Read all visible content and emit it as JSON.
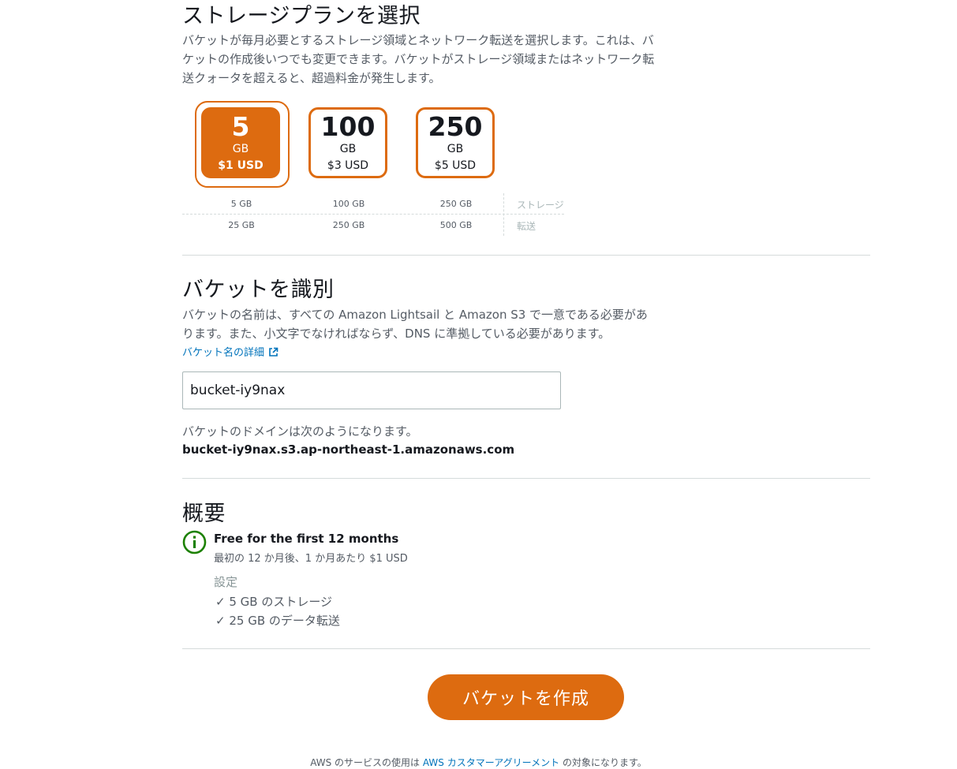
{
  "storage_plan": {
    "title": "ストレージプランを選択",
    "description": "バケットが毎月必要とするストレージ領域とネットワーク転送を選択します。これは、バケットの作成後いつでも変更できます。バケットがストレージ領域またはネットワーク転送クォータを超えると、超過料金が発生します。",
    "plans": [
      {
        "size": "5",
        "unit": "GB",
        "price": "$1 USD",
        "storage": "5 GB",
        "transfer": "25 GB",
        "selected": true
      },
      {
        "size": "100",
        "unit": "GB",
        "price": "$3 USD",
        "storage": "100 GB",
        "transfer": "250 GB",
        "selected": false
      },
      {
        "size": "250",
        "unit": "GB",
        "price": "$5 USD",
        "storage": "250 GB",
        "transfer": "500 GB",
        "selected": false
      }
    ],
    "row_labels": {
      "storage": "ストレージ",
      "transfer": "転送"
    }
  },
  "identify": {
    "title": "バケットを識別",
    "description": "バケットの名前は、すべての Amazon Lightsail と Amazon S3 で一意である必要があります。また、小文字でなければならず、DNS に準拠している必要があります。",
    "link_label": "バケット名の詳細",
    "bucket_name": "bucket-iy9nax",
    "domain_label": "バケットのドメインは次のようになります。",
    "domain_value": "bucket-iy9nax.s3.ap-northeast-1.amazonaws.com"
  },
  "summary": {
    "title": "概要",
    "free_title": "Free for the first 12 months",
    "free_sub": "最初の 12 か月後、1 か月あたり $1 USD",
    "settings_label": "設定",
    "items": [
      "✓ 5 GB のストレージ",
      "✓ 25 GB のデータ転送"
    ]
  },
  "actions": {
    "create_label": "バケットを作成"
  },
  "footer": {
    "prefix": "AWS のサービスの使用は",
    "link": "AWS カスタマーアグリーメント",
    "suffix": "の対象になります。"
  },
  "colors": {
    "accent": "#dd6b10",
    "link": "#0073bb",
    "info_green": "#1d8102"
  }
}
